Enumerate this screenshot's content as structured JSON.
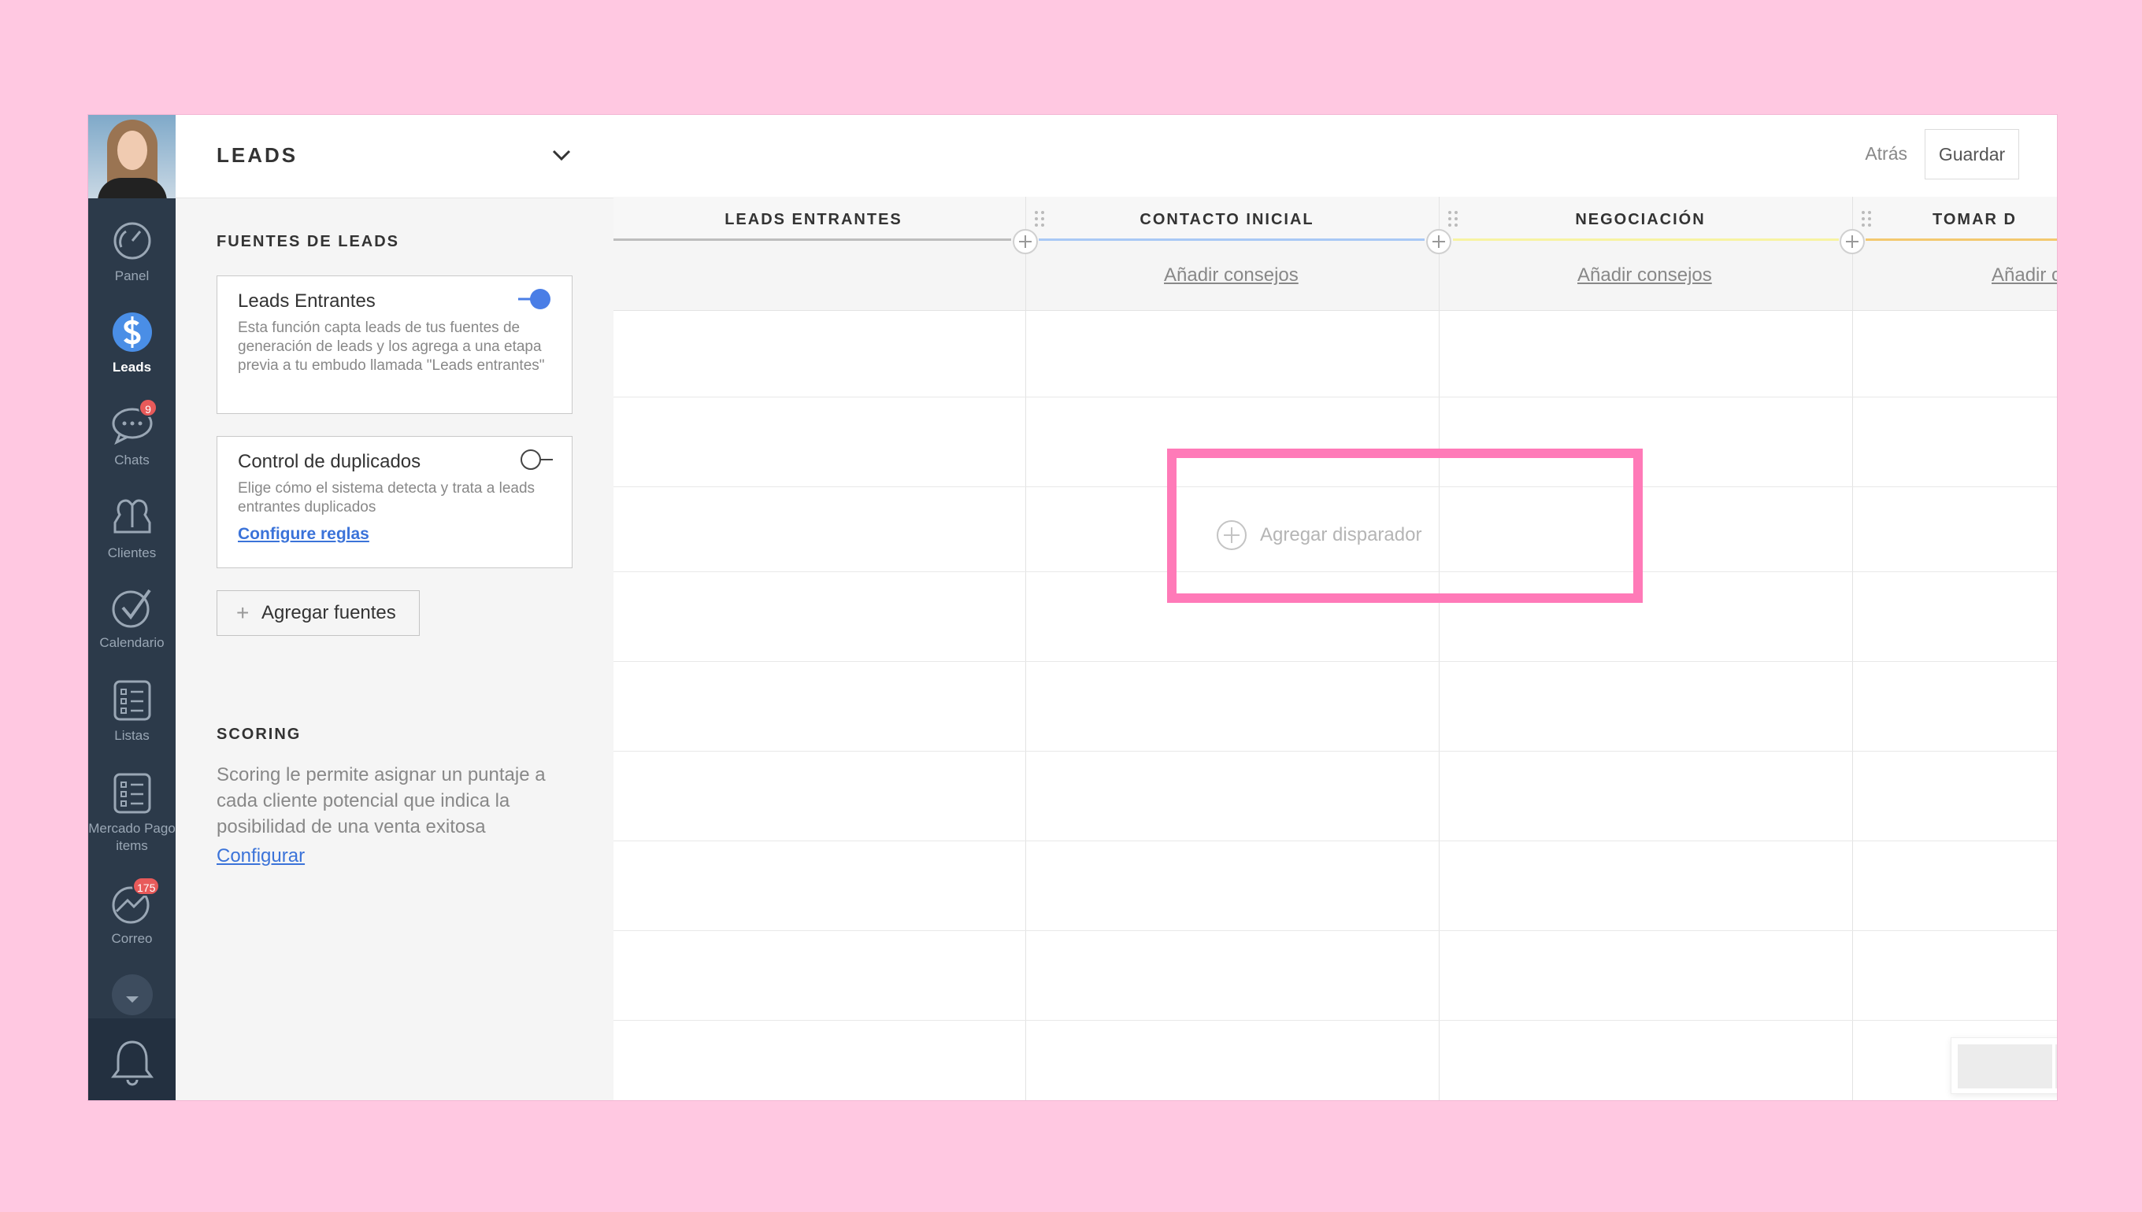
{
  "nav": {
    "items": [
      {
        "label": "Panel",
        "icon": "speedometer-icon"
      },
      {
        "label": "Leads",
        "icon": "dollar-icon"
      },
      {
        "label": "Chats",
        "icon": "chat-icon",
        "badge": "9"
      },
      {
        "label": "Clientes",
        "icon": "people-icon"
      },
      {
        "label": "Calendario",
        "icon": "checkmark-icon"
      },
      {
        "label": "Listas",
        "icon": "list-icon"
      },
      {
        "label": "Mercado Pago items",
        "icon": "list-icon"
      },
      {
        "label": "Correo",
        "icon": "mail-icon",
        "badge": "175"
      }
    ]
  },
  "panel": {
    "title": "LEADS",
    "sources_heading": "FUENTES DE LEADS",
    "card_incoming": {
      "title": "Leads Entrantes",
      "description": "Esta función capta leads de tus fuentes de generación de leads y los agrega a una etapa previa a tu embudo llamada \"Leads entrantes\"",
      "enabled": true
    },
    "card_duplicates": {
      "title": "Control de duplicados",
      "description": "Elige cómo el sistema detecta y trata a leads entrantes duplicados",
      "link": "Configure reglas",
      "enabled": false
    },
    "add_sources": "Agregar fuentes",
    "scoring_heading": "SCORING",
    "scoring_desc": "Scoring le permite asignar un puntaje a cada cliente potencial que indica la posibilidad de una venta exitosa",
    "scoring_link": "Configurar"
  },
  "topbar": {
    "back": "Atrás",
    "save": "Guardar"
  },
  "columns": [
    {
      "name": "LEADS ENTRANTES",
      "color": "#bdbdbd",
      "tip": ""
    },
    {
      "name": "CONTACTO INICIAL",
      "color": "#a9c9f5",
      "tip": "Añadir consejos"
    },
    {
      "name": "NEGOCIACIÓN",
      "color": "#f7f3a2",
      "tip": "Añadir consejos"
    },
    {
      "name": "TOMAR D",
      "color": "#f3c96f",
      "tip": "Añadir c"
    }
  ],
  "trigger": {
    "label": "Agregar disparador"
  },
  "colors": {
    "background": "#ffc8e1",
    "nav": "#2c3a4a",
    "accent": "#3b73d9",
    "highlight": "#ff7ab8"
  }
}
